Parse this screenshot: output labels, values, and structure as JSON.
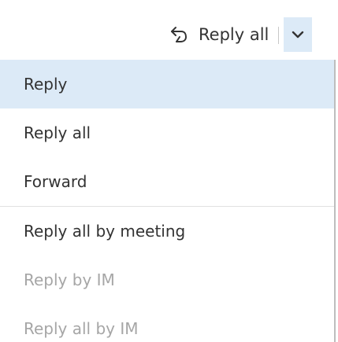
{
  "toolbar": {
    "reply_all_label": "Reply all",
    "reply_all_icon": "reply-all-icon",
    "dropdown_icon": "chevron-down-icon",
    "accent_bg": "#dceaf7"
  },
  "menu": {
    "group1": [
      {
        "label": "Reply",
        "state": "selected"
      },
      {
        "label": "Reply all",
        "state": "normal"
      },
      {
        "label": "Forward",
        "state": "normal"
      }
    ],
    "group2": [
      {
        "label": "Reply all by meeting",
        "state": "normal"
      },
      {
        "label": "Reply by IM",
        "state": "disabled"
      },
      {
        "label": "Reply all by IM",
        "state": "disabled"
      }
    ]
  }
}
